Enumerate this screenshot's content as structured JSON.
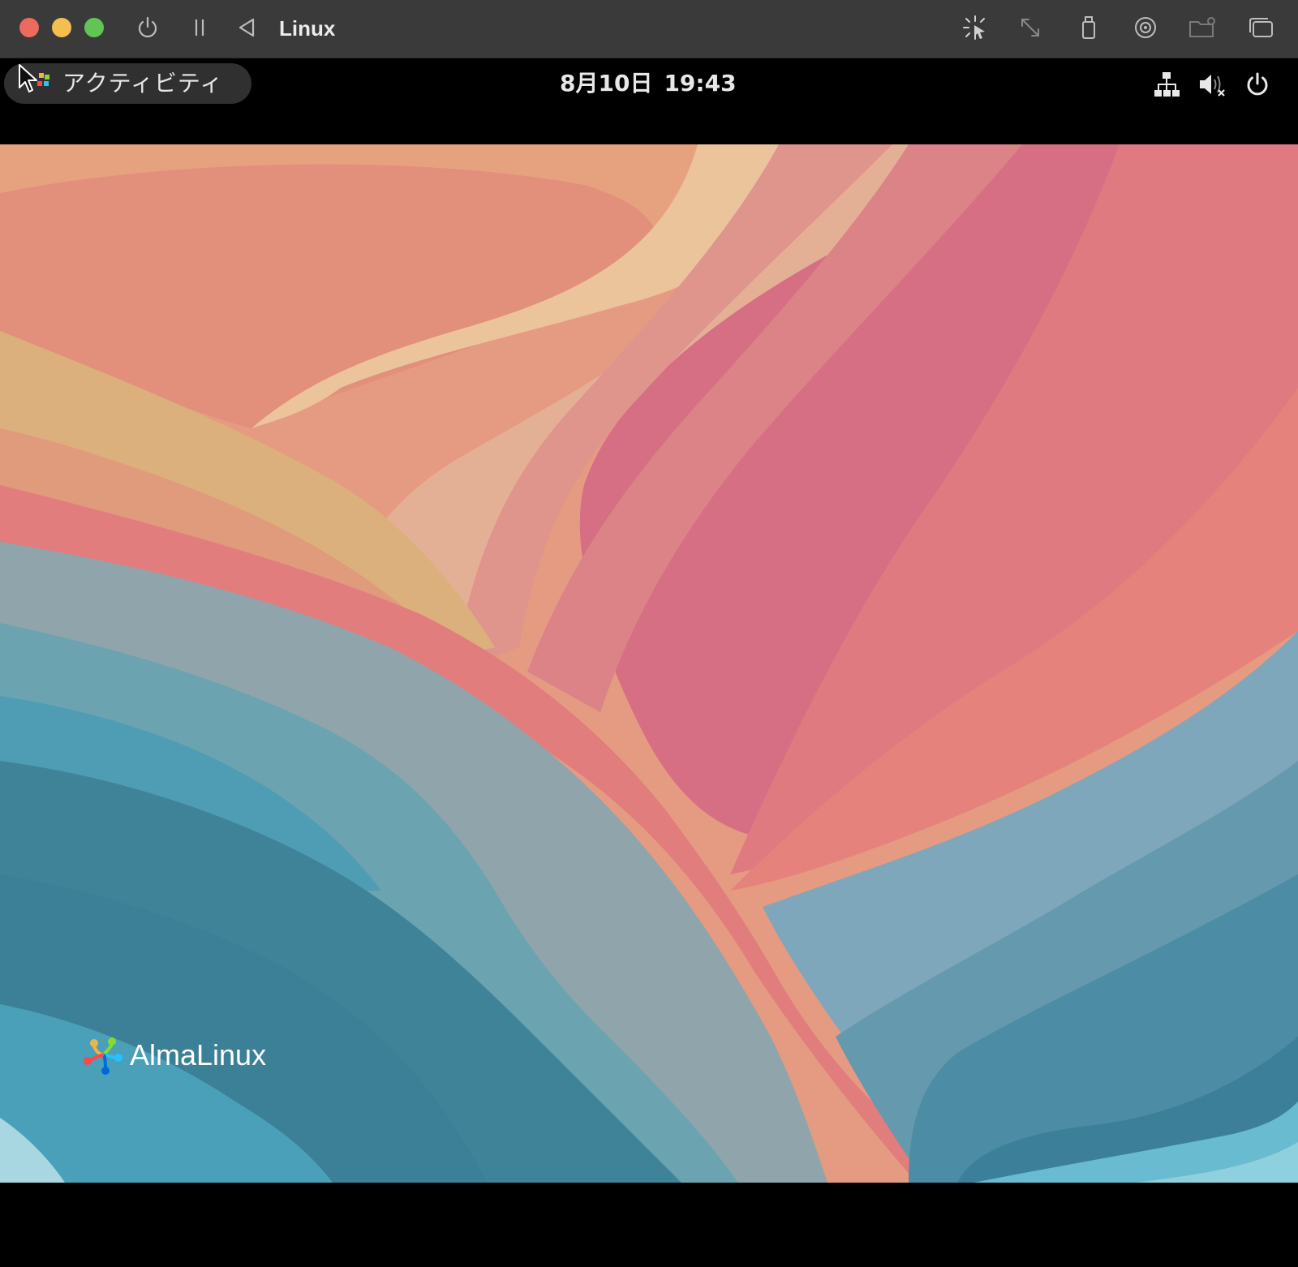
{
  "window": {
    "title": "Linux",
    "toolbar_icons": [
      "power-icon",
      "pause-icon",
      "back-icon",
      "capture-pointer-icon",
      "resize-icon",
      "usb-icon",
      "disc-icon",
      "shared-folder-icon",
      "window-icon"
    ]
  },
  "gnome_top_bar": {
    "activities_label": "アクティビティ",
    "date": "8月10日",
    "time": "19:43",
    "status_icons": [
      "network-icon",
      "volume-muted-icon",
      "power-icon"
    ]
  },
  "desktop": {
    "logo_text": "AlmaLinux"
  },
  "colors": {
    "titlebar": "#3a3a3a",
    "close": "#ed6a5e",
    "minimize": "#f5bf4f",
    "maximize": "#61c554",
    "wall_peach": "#e6a07f",
    "wall_pink": "#d9707f",
    "wall_teal": "#3f8399",
    "wall_gray_band": "#8fa5ab"
  }
}
